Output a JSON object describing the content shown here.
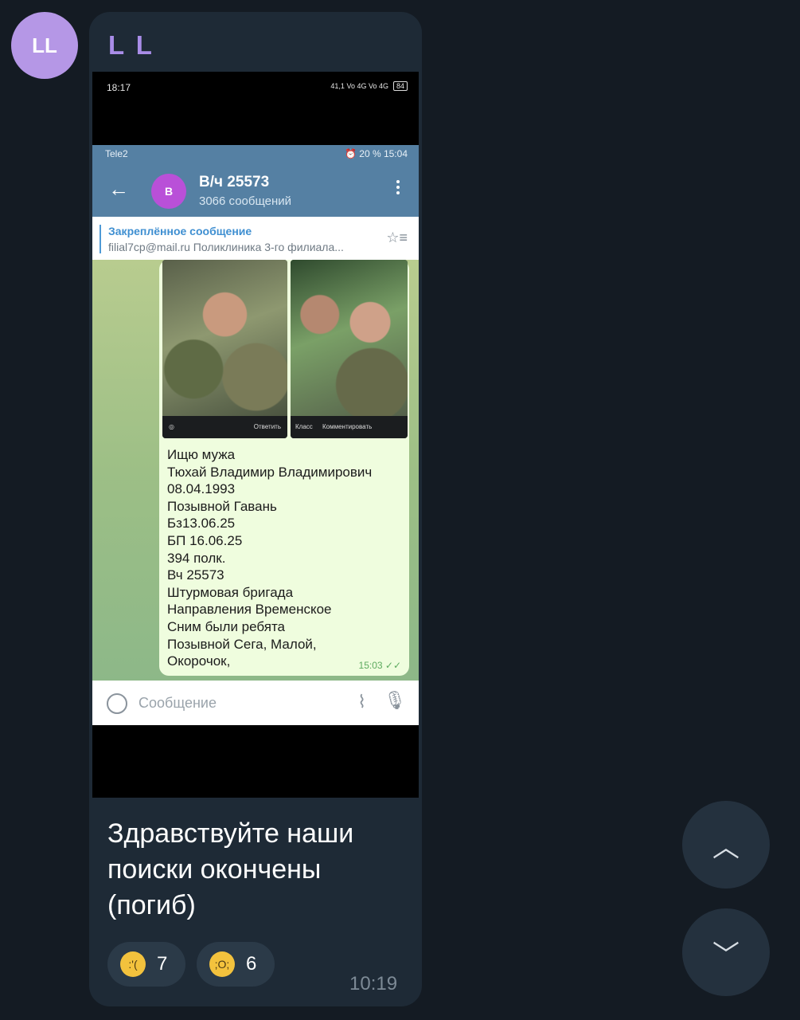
{
  "sender": {
    "initials": "LL",
    "name": "L L"
  },
  "phone_status": {
    "time": "18:17",
    "right": "41,1 Vo 4G Vo 4G",
    "battery": "84"
  },
  "telegram": {
    "status_left": "Tele2",
    "status_right": "⏰ 20 % 15:04",
    "channel_initial": "В",
    "channel_name": "В/ч 25573",
    "channel_sub": "3066 сообщений",
    "pinned_title": "Закреплённое сообщение",
    "pinned_text": "filial7cp@mail.ru Поликлиника 3-го филиала...",
    "photo1_action": "Ответить",
    "photo2_left": "Класс",
    "photo2_action": "Комментировать",
    "message_lines": [
      "Ищю мужа",
      "Тюхай Владимир Владимирович",
      "08.04.1993",
      "Позывной Гавань",
      "Бз13.06.25",
      "БП 16.06.25",
      "394 полк.",
      "Вч 25573",
      "Штурмовая бригада",
      "Направления Временское",
      "Сним были ребята",
      "Позывной Сега, Малой,",
      "Окорочок,"
    ],
    "message_time": "15:03",
    "compose_placeholder": "Сообщение"
  },
  "caption_lines": [
    "Здравствуйте наши",
    "поиски окончены",
    "(погиб)"
  ],
  "reactions": [
    {
      "icon": "crying-face-icon",
      "count": "7"
    },
    {
      "icon": "loudly-crying-face-icon",
      "count": "6"
    }
  ],
  "message_time": "10:19",
  "colors": {
    "background": "#141b23",
    "bubble": "#1e2a36",
    "accent": "#a98de8"
  }
}
